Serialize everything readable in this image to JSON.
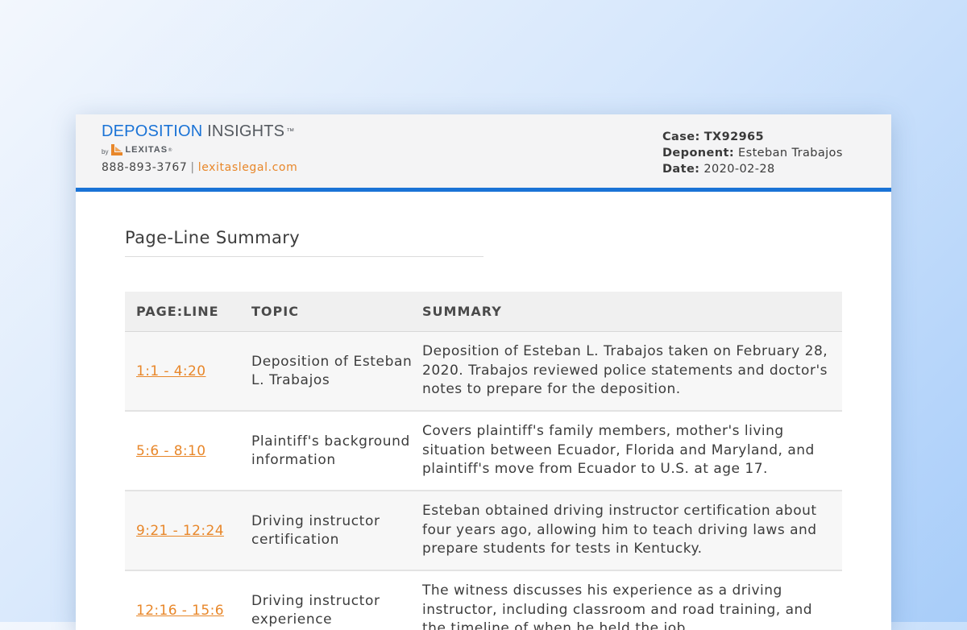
{
  "brand": {
    "name_primary": "DEPOSITION",
    "name_secondary": "INSIGHTS",
    "trademark": "™",
    "by": "by",
    "company": "LEXITAS",
    "company_mark": "®"
  },
  "contact": {
    "phone": "888-893-3767",
    "separator": "|",
    "website": "lexitaslegal.com"
  },
  "case_info": {
    "case_label": "Case:",
    "case_value": "TX92965",
    "deponent_label": "Deponent:",
    "deponent_value": "Esteban Trabajos",
    "date_label": "Date:",
    "date_value": "2020-02-28"
  },
  "section": {
    "title": "Page-Line Summary"
  },
  "table": {
    "headers": {
      "page_line": "PAGE:LINE",
      "topic": "TOPIC",
      "summary": "SUMMARY"
    },
    "rows": [
      {
        "page_line": "1:1 - 4:20",
        "topic": "Deposition of Esteban L. Trabajos",
        "summary": "Deposition of Esteban L. Trabajos taken on February 28, 2020. Trabajos reviewed police statements and doctor's notes to prepare for the deposition."
      },
      {
        "page_line": "5:6 - 8:10",
        "topic": "Plaintiff's background information",
        "summary": "Covers plaintiff's family members, mother's living situation between Ecuador, Florida and Maryland, and plaintiff's move from Ecuador to U.S. at age 17."
      },
      {
        "page_line": "9:21 - 12:24",
        "topic": "Driving instructor certification",
        "summary": "Esteban obtained driving instructor certification about four years ago, allowing him to teach driving laws and prepare students for tests in Kentucky."
      },
      {
        "page_line": "12:16 - 15:6",
        "topic": "Driving instructor experience",
        "summary": "The witness discusses his experience as a driving instructor, including classroom and road training, and the timeline of when he held the job."
      }
    ]
  },
  "colors": {
    "accent_blue": "#1a73d6",
    "accent_orange": "#e8872a"
  }
}
